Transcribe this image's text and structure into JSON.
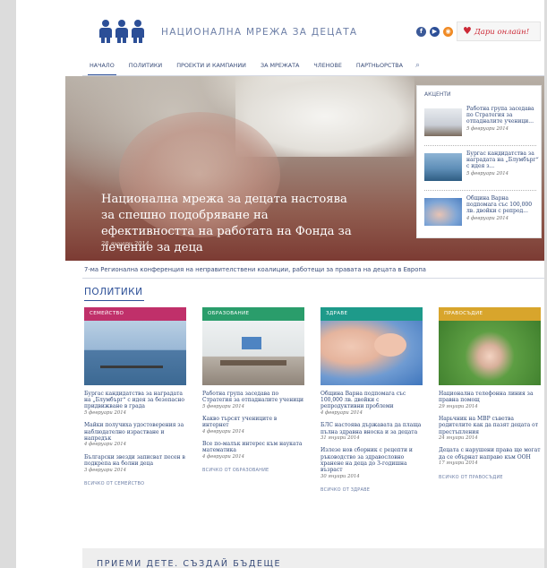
{
  "header": {
    "site_title": "НАЦИОНАЛНА МРЕЖА ЗА ДЕЦАТА",
    "donate_label": "Дари онлайн!",
    "social": [
      {
        "icon": "facebook-icon",
        "glyph": "f",
        "color": "#3b5998"
      },
      {
        "icon": "youtube-icon",
        "glyph": "▶",
        "color": "#2c4f97"
      },
      {
        "icon": "rss-icon",
        "glyph": "◉",
        "color": "#f08a24"
      }
    ]
  },
  "nav": {
    "items": [
      "НАЧАЛО",
      "ПОЛИТИКИ",
      "ПРОЕКТИ И КАМПАНИИ",
      "ЗА МРЕЖАТА",
      "ЧЛЕНОВЕ",
      "ПАРТНЬОРСТВА"
    ],
    "active_index": 0
  },
  "hero": {
    "title": "Национална мрежа за децата настоява за спешно подобряване на ефективността на работата на Фонда за лечение за деца",
    "date": "28 януари 2014"
  },
  "highlights": {
    "title": "АКЦЕНТИ",
    "items": [
      {
        "text": "Работна група заседава по Стратегия за отпадналите ученици...",
        "date": "5 февруари 2014"
      },
      {
        "text": "Бургас кандидатства за наградата на „Блумбърг“ с идея з...",
        "date": "5 февруари 2014"
      },
      {
        "text": "Община Варна подпомага със 100,000 лв. двойки с репрод...",
        "date": "4 февруари 2014"
      }
    ]
  },
  "ticker": {
    "text": "7-ма Регионална конференция на неправителствени коалиции, работещи за правата на децата в Европа"
  },
  "policies": {
    "title": "ПОЛИТИКИ",
    "columns": [
      {
        "label": "СЕМЕЙСТВО",
        "color": "#c0306a",
        "articles": [
          {
            "text": "Бургас кандидатства за наградата на „Блумбърг“ с идея за безопасно придвижване в града",
            "date": "5 февруари 2014"
          },
          {
            "text": "Майки получиха удостоверения за наблюдателно израстване и напредък",
            "date": "4 февруари 2014"
          },
          {
            "text": "Български звезди записват песен в подкрепа на болни деца",
            "date": "3 февруари 2014"
          }
        ],
        "more": "ВСИЧКО ОТ СЕМЕЙСТВО"
      },
      {
        "label": "ОБРАЗОВАНИЕ",
        "color": "#2a9d6b",
        "articles": [
          {
            "text": "Работна група заседава по Стратегия за отпадналите ученици",
            "date": "5 февруари 2014"
          },
          {
            "text": "Какво търсят учениците в интернет",
            "date": "4 февруари 2014"
          },
          {
            "text": "Все по-малък интерес към науката математика",
            "date": "4 февруари 2014"
          }
        ],
        "more": "ВСИЧКО ОТ ОБРАЗОВАНИЕ"
      },
      {
        "label": "ЗДРАВЕ",
        "color": "#1e9a8a",
        "articles": [
          {
            "text": "Община Варна подпомага със 100,000 лв. двойки с репродуктивни проблеми",
            "date": "4 февруари 2014"
          },
          {
            "text": "БЛС настоява държавата да плаща пълна здравна вноска и за децата",
            "date": "31 януари 2014"
          },
          {
            "text": "Излезе нов сборник с рецепти и ръководство за здравословно хранене на деца до 3-годишна възраст",
            "date": "30 януари 2014"
          }
        ],
        "more": "ВСИЧКО ОТ ЗДРАВЕ"
      },
      {
        "label": "ПРАВОСЪДИЕ",
        "color": "#d8a52c",
        "articles": [
          {
            "text": "Национална телефонна линия за правна помощ",
            "date": "29 януари 2014"
          },
          {
            "text": "Нарьчник на МВР съветва родителите как да пазят децата от престъпления",
            "date": "24 януари 2014"
          },
          {
            "text": "Децата с нарушени права ще могат да се обърнат направо към ООН",
            "date": "17 януари 2014"
          }
        ],
        "more": "ВСИЧКО ОТ ПРАВОСЪДИЕ"
      }
    ]
  },
  "footer": {
    "banner_text": "ПРИЕМИ ДЕТЕ. СЪЗДАЙ БЪДЕЩЕ"
  }
}
